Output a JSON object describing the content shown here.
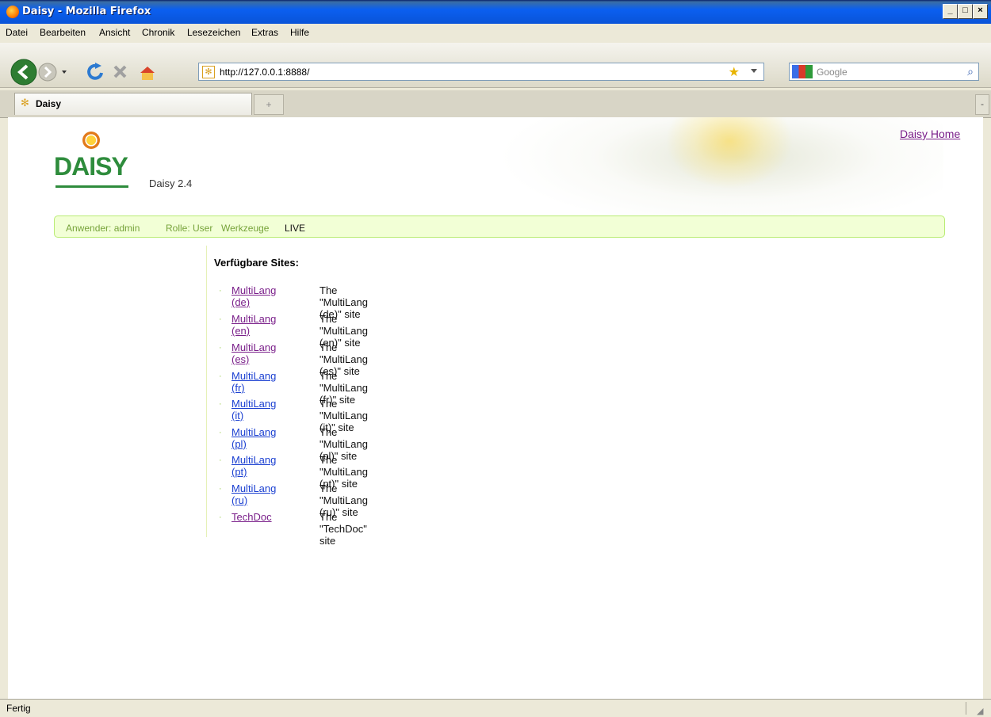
{
  "window": {
    "title": "Daisy - Mozilla Firefox",
    "min": "_",
    "max": "□",
    "close": "×"
  },
  "menu": [
    "Datei",
    "Bearbeiten",
    "Ansicht",
    "Chronik",
    "Lesezeichen",
    "Extras",
    "Hilfe"
  ],
  "toolbar": {
    "url": "http://127.0.0.1:8888/",
    "search_placeholder": "Google"
  },
  "tabs": [
    {
      "label": "Daisy"
    }
  ],
  "page": {
    "logo_text": "DAISY",
    "version": "Daisy 2.4",
    "home_link": "Daisy Home",
    "userbar": {
      "user": "Anwender: admin",
      "role": "Rolle: User",
      "tools": "Werkzeuge",
      "mode": "LIVE"
    },
    "sites_title": "Verfügbare Sites:",
    "sites": [
      {
        "name": "MultiLang (de)",
        "desc": "The \"MultiLang (de)\" site",
        "visited": true
      },
      {
        "name": "MultiLang (en)",
        "desc": "The \"MultiLang (en)\" site",
        "visited": true
      },
      {
        "name": "MultiLang (es)",
        "desc": "The \"MultiLang (es)\" site",
        "visited": true
      },
      {
        "name": "MultiLang (fr)",
        "desc": "The \"MultiLang (fr)\" site",
        "visited": false
      },
      {
        "name": "MultiLang (it)",
        "desc": "The \"MultiLang (it)\" site",
        "visited": false
      },
      {
        "name": "MultiLang (pl)",
        "desc": "The \"MultiLang (pl)\" site",
        "visited": false
      },
      {
        "name": "MultiLang (pt)",
        "desc": "The \"MultiLang (pt)\" site",
        "visited": false
      },
      {
        "name": "MultiLang (ru)",
        "desc": "The \"MultiLang (ru)\" site",
        "visited": false
      },
      {
        "name": "TechDoc",
        "desc": "The \"TechDoc\" site",
        "visited": true
      }
    ]
  },
  "status": {
    "text": "Fertig"
  },
  "colors": {
    "link": "#1a3fd1",
    "visited": "#7a1f8a",
    "green": "#2e8c3c"
  }
}
